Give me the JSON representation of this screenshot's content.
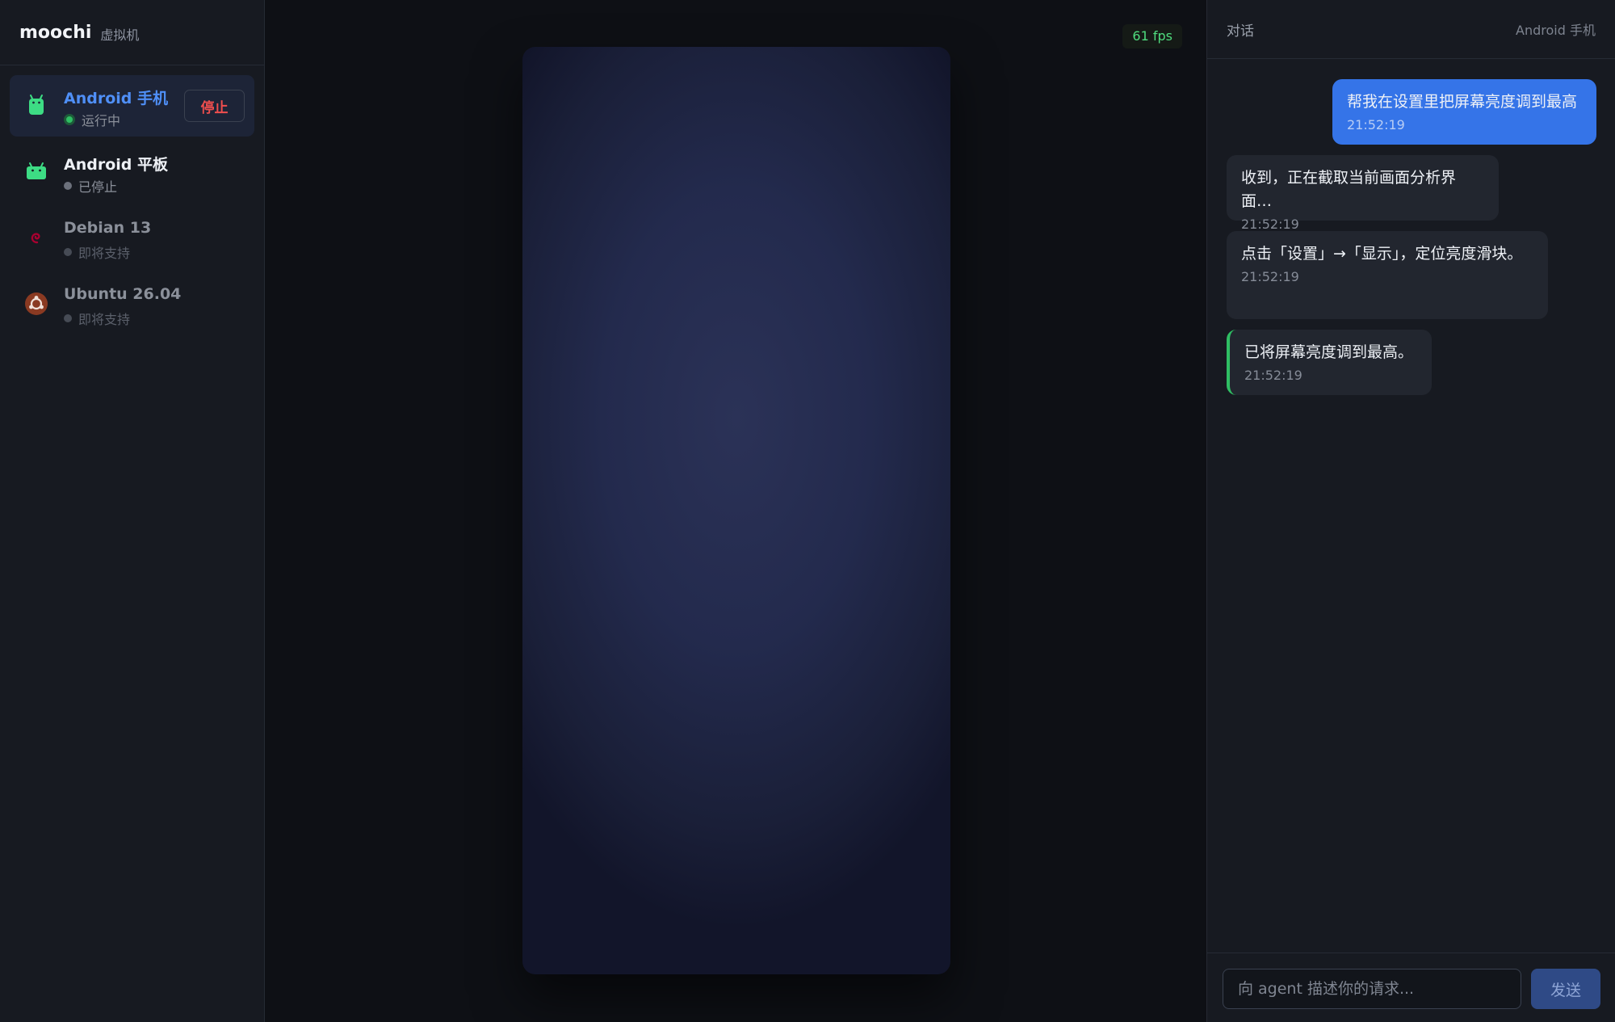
{
  "brand": {
    "name": "moochi",
    "subtitle": "虚拟机"
  },
  "vms": [
    {
      "name": "Android 手机",
      "status": "运行中",
      "state": "running",
      "action": "停止",
      "icon": "android-phone-icon"
    },
    {
      "name": "Android 平板",
      "status": "已停止",
      "state": "stopped",
      "icon": "android-tablet-icon"
    },
    {
      "name": "Debian 13",
      "status": "即将支持",
      "state": "soon",
      "icon": "debian-logo-icon"
    },
    {
      "name": "Ubuntu 26.04",
      "status": "即将支持",
      "state": "soon",
      "icon": "ubuntu-logo-icon"
    }
  ],
  "screen": {
    "fps": "61 fps"
  },
  "chat": {
    "title": "对话",
    "device": "Android 手机",
    "messages": [
      {
        "role": "user",
        "text": "帮我在设置里把屏幕亮度调到最高",
        "time": "21:52:19"
      },
      {
        "role": "agent",
        "text": "收到，正在截取当前画面分析界面…",
        "time": "21:52:19"
      },
      {
        "role": "agent",
        "text": "点击「设置」→「显示」，定位亮度滑块。",
        "time": "21:52:19"
      },
      {
        "role": "done",
        "text": "已将屏幕亮度调到最高。",
        "time": "21:52:19"
      }
    ],
    "input_placeholder": "向 agent 描述你的请求...",
    "send_label": "发送"
  },
  "colors": {
    "accent": "#3574e8",
    "running": "#2fbe63",
    "stop": "#ef4e4e",
    "android": "#3ddc84",
    "debian": "#a80030",
    "ubuntu": "#e95420"
  }
}
